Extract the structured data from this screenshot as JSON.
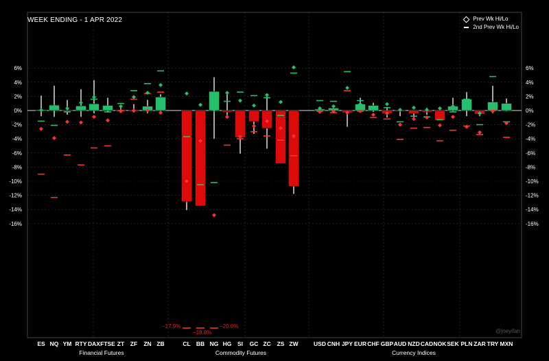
{
  "title": "WEEK ENDING - 1 APR 2022",
  "legend": {
    "prev": "Prev Wk Hi/Lo",
    "second": "2nd Prev Wk Hi/Lo"
  },
  "watermark": "@joeyifan",
  "colors": {
    "up": "#22c06b",
    "down": "#dd0a0a",
    "prev": "#22c06b",
    "second": "#ff3030",
    "wick": "#ffffff",
    "grid": "#3a3a3a"
  },
  "overflow_labels": {
    "cl": "−17.9%",
    "bb": "−18.8%",
    "ng": "−20.0%"
  },
  "chart_data": {
    "type": "bar",
    "ylim": [
      -16,
      7
    ],
    "yticks": [
      "6%",
      "4%",
      "2%",
      "0%",
      "-2%",
      "-4%",
      "-6%",
      "-8%",
      "-10%",
      "-12%",
      "-14%",
      "-16%"
    ],
    "groups": [
      {
        "name": "Financial Futures",
        "items": [
          {
            "label": "ES",
            "open": 0,
            "close": 0.1,
            "high": 2.1,
            "low": -0.8,
            "prev_green": 0.05,
            "prev_red": -2.6,
            "second_green": -1.5,
            "second_red": -9.0
          },
          {
            "label": "NQ",
            "open": 0,
            "close": 0.75,
            "high": 3.5,
            "low": -0.9,
            "prev_green": 0.6,
            "prev_red": -3.9,
            "second_green": -2.1,
            "second_red": -12.3
          },
          {
            "label": "YM",
            "open": 0,
            "close": -0.1,
            "high": 1.5,
            "low": -0.6,
            "prev_green": 0.3,
            "prev_red": -1.6,
            "second_green": -0.2,
            "second_red": -6.3
          },
          {
            "label": "RTY",
            "open": 0,
            "close": 0.65,
            "high": 3.0,
            "low": -0.9,
            "prev_green": 1.1,
            "prev_red": -1.7,
            "second_green": 0.3,
            "second_red": -7.7
          },
          {
            "label": "DAX",
            "open": 0,
            "close": 0.95,
            "high": 4.3,
            "low": -0.4,
            "prev_green": 1.9,
            "prev_red": -0.9,
            "second_green": 1.6,
            "second_red": -5.3
          },
          {
            "label": "FTSE",
            "open": 0,
            "close": 0.7,
            "high": 1.8,
            "low": -0.3,
            "prev_green": 0.5,
            "prev_red": -1.4,
            "second_green": -0.2,
            "second_red": -5.0
          },
          {
            "label": "ZT",
            "open": 0,
            "close": -0.1,
            "high": 0.7,
            "low": -0.2,
            "prev_green": 0.6,
            "prev_red": -0.1,
            "second_green": 1.0,
            "second_red": 0.0
          },
          {
            "label": "ZF",
            "open": 0,
            "close": -0.15,
            "high": 0.9,
            "low": -0.3,
            "prev_green": 1.9,
            "prev_red": 0.0,
            "second_green": 2.8,
            "second_red": 1.6
          },
          {
            "label": "ZN",
            "open": 0,
            "close": 0.6,
            "high": 1.5,
            "low": -0.4,
            "prev_green": 2.5,
            "prev_red": 0.0,
            "second_green": 3.8,
            "second_red": 2.4
          },
          {
            "label": "ZB",
            "open": 0,
            "close": 1.9,
            "high": 2.3,
            "low": -0.3,
            "prev_green": 3.6,
            "prev_red": -0.3,
            "second_green": 5.6,
            "second_red": 2.6
          }
        ]
      },
      {
        "name": "Commodity Futures",
        "items": [
          {
            "label": "CL",
            "open": 0,
            "close": -12.9,
            "high": 0.0,
            "low": -14.1,
            "prev_green": 2.4,
            "prev_red": -10.0,
            "second_green": -3.7,
            "second_red": -17.9
          },
          {
            "label": "BB",
            "open": 0,
            "close": -13.5,
            "high": 0.0,
            "low": -13.5,
            "prev_green": 0.8,
            "prev_red": -4.3,
            "second_green": -10.5,
            "second_red": -18.8
          },
          {
            "label": "NG",
            "open": 0,
            "close": 2.7,
            "high": 4.7,
            "low": -4.0,
            "prev_green": 0.1,
            "prev_red": -14.8,
            "second_green": -10.2,
            "second_red": -20.0
          },
          {
            "label": "HG",
            "open": 0,
            "close": -0.2,
            "high": 2.7,
            "low": -1.1,
            "prev_green": 2.5,
            "prev_red": -0.9,
            "second_green": 1.3,
            "second_red": -4.9
          },
          {
            "label": "SI",
            "open": 0,
            "close": -3.8,
            "high": 0.0,
            "low": -6.1,
            "prev_green": 1.4,
            "prev_red": -3.7,
            "second_green": 2.6,
            "second_red": -4.0
          },
          {
            "label": "GC",
            "open": 0,
            "close": -1.55,
            "high": 0.0,
            "low": -3.3,
            "prev_green": 0.7,
            "prev_red": -2.2,
            "second_green": 2.1,
            "second_red": -3.0
          },
          {
            "label": "ZC",
            "open": 0,
            "close": -2.5,
            "high": 2.1,
            "low": -5.4,
            "prev_green": 2.2,
            "prev_red": -1.5,
            "second_green": 1.8,
            "second_red": -3.6
          },
          {
            "label": "ZS",
            "open": 0,
            "close": -7.5,
            "high": 0.0,
            "low": -7.5,
            "prev_green": 1.2,
            "prev_red": -2.5,
            "second_green": -0.7,
            "second_red": -4.2
          },
          {
            "label": "ZW",
            "open": 0,
            "close": -10.7,
            "high": 0.0,
            "low": -11.8,
            "prev_green": 6.1,
            "prev_red": -3.6,
            "second_green": 5.3,
            "second_red": -6.4
          }
        ]
      },
      {
        "name": "Currency Indices",
        "items": [
          {
            "label": "USD",
            "open": 0,
            "close": 0.2,
            "high": 0.5,
            "low": -0.3,
            "prev_green": 0.3,
            "prev_red": -0.2,
            "second_green": 1.4,
            "second_red": -0.1
          },
          {
            "label": "CNH",
            "open": 0,
            "close": 0.35,
            "high": 0.6,
            "low": 0.0,
            "prev_green": 0.6,
            "prev_red": -0.1,
            "second_green": 1.3,
            "second_red": -0.3
          },
          {
            "label": "JPY",
            "open": 0,
            "close": -0.3,
            "high": 0.0,
            "low": -2.3,
            "prev_green": 3.2,
            "prev_red": -0.3,
            "second_green": 5.5,
            "second_red": 2.8
          },
          {
            "label": "EUR",
            "open": 0,
            "close": 0.9,
            "high": 1.8,
            "low": -0.1,
            "prev_green": 0.9,
            "prev_red": -0.1,
            "second_green": 1.4,
            "second_red": -0.1
          },
          {
            "label": "CHF",
            "open": 0,
            "close": 0.7,
            "high": 1.1,
            "low": -0.2,
            "prev_green": 0.4,
            "prev_red": -0.6,
            "second_green": 0.6,
            "second_red": -1.0
          },
          {
            "label": "GBP",
            "open": 0,
            "close": -0.4,
            "high": 0.5,
            "low": -1.0,
            "prev_green": 0.9,
            "prev_red": -0.4,
            "second_green": 0.4,
            "second_red": -1.2
          },
          {
            "label": "AUD",
            "open": 0,
            "close": -0.05,
            "high": 0.3,
            "low": -0.8,
            "prev_green": 0.1,
            "prev_red": -2.0,
            "second_green": -1.6,
            "second_red": -4.1
          },
          {
            "label": "NZD",
            "open": 0,
            "close": -0.4,
            "high": 0.0,
            "low": -1.1,
            "prev_green": 0.4,
            "prev_red": -1.2,
            "second_green": -0.8,
            "second_red": -2.5
          },
          {
            "label": "CAD",
            "open": 0,
            "close": -0.2,
            "high": 0.4,
            "low": -0.6,
            "prev_green": 0.1,
            "prev_red": -1.0,
            "second_green": -0.9,
            "second_red": -2.4
          },
          {
            "label": "NOK",
            "open": 0,
            "close": -1.4,
            "high": 0.0,
            "low": -1.4,
            "prev_green": 0.3,
            "prev_red": -2.1,
            "second_green": -1.3,
            "second_red": -4.3
          },
          {
            "label": "SEK",
            "open": 0,
            "close": 0.6,
            "high": 1.8,
            "low": -0.1,
            "prev_green": 0.6,
            "prev_red": -0.9,
            "second_green": -0.2,
            "second_red": -2.8
          },
          {
            "label": "PLN",
            "open": 0,
            "close": 1.6,
            "high": 2.6,
            "low": -0.8,
            "prev_green": 0.8,
            "prev_red": -2.3,
            "second_green": 1.6,
            "second_red": -2.2
          },
          {
            "label": "ZAR",
            "open": 0,
            "close": -0.5,
            "high": 0.0,
            "low": -0.8,
            "prev_green": -0.4,
            "prev_red": -3.1,
            "second_green": -2.0,
            "second_red": -3.4
          },
          {
            "label": "TRY",
            "open": 0,
            "close": 1.2,
            "high": 3.5,
            "low": -0.4,
            "prev_green": 0.6,
            "prev_red": -0.1,
            "second_green": 4.8,
            "second_red": 0.0
          },
          {
            "label": "MXN",
            "open": 0,
            "close": 1.0,
            "high": 1.7,
            "low": -0.1,
            "prev_green": 0.6,
            "prev_red": -1.8,
            "second_green": -1.6,
            "second_red": -3.8
          }
        ]
      }
    ]
  }
}
